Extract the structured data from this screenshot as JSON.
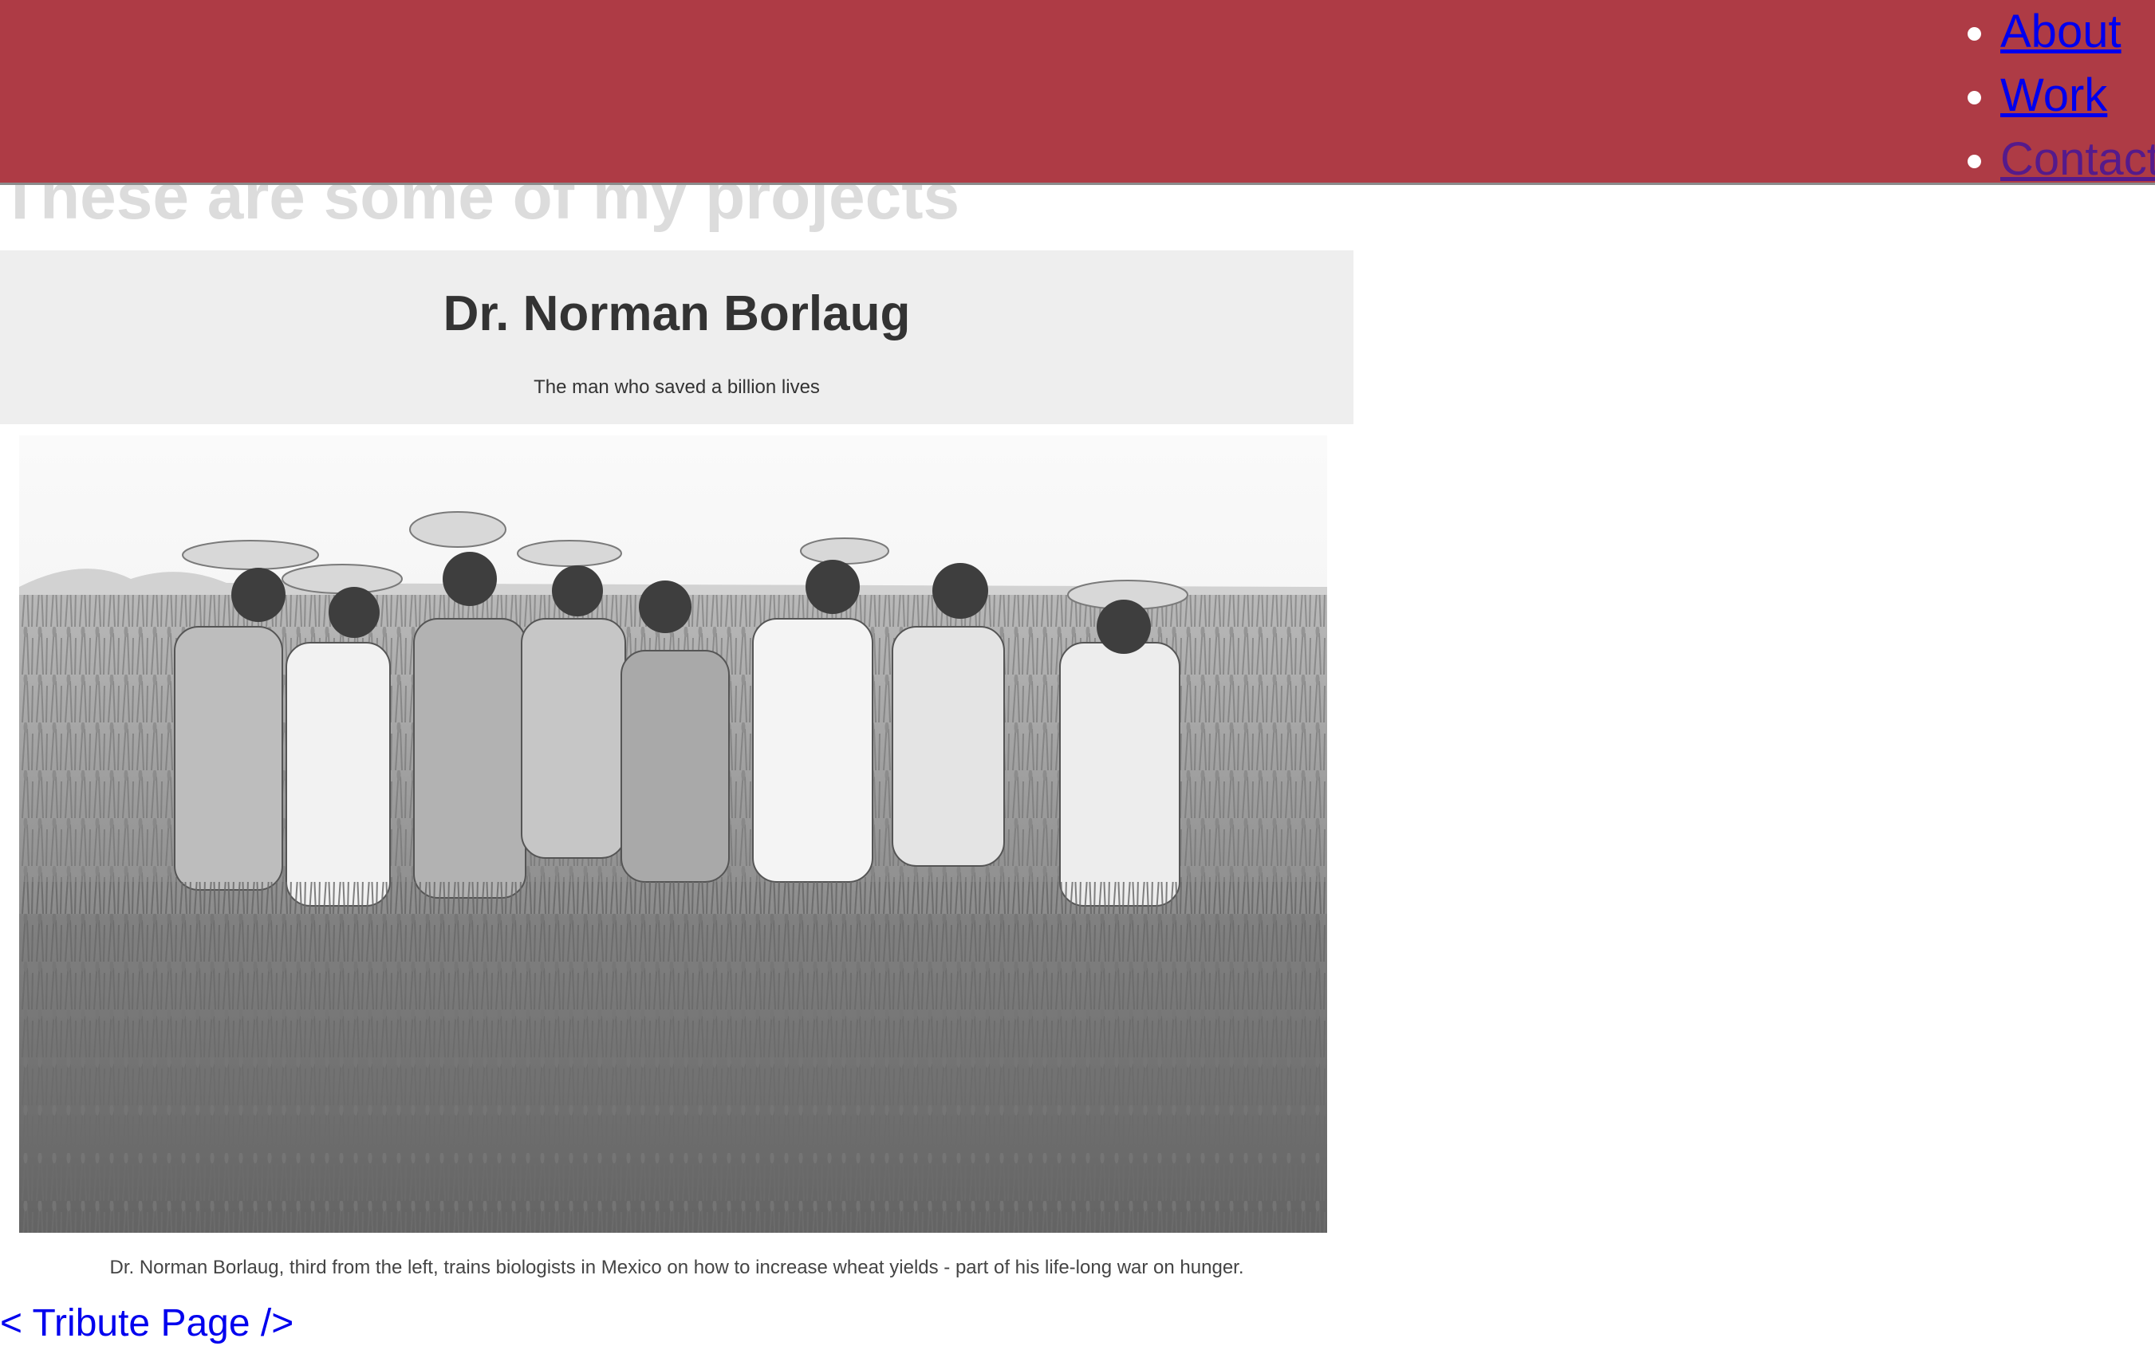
{
  "nav": {
    "items": [
      {
        "label": "About"
      },
      {
        "label": "Work"
      },
      {
        "label": "Contact"
      }
    ]
  },
  "projects": {
    "heading": "These are some of my projects",
    "tile": {
      "title": "Dr. Norman Borlaug",
      "subtitle": "The man who saved a billion lives",
      "caption": "Dr. Norman Borlaug, third from the left, trains biologists in Mexico on how to increase wheat yields - part of his life-long war on hunger.",
      "link_text": "< Tribute Page />"
    }
  },
  "colors": {
    "nav_background": "#ae3b45",
    "link": "#0000ee",
    "visited_link": "#551a8b",
    "tile_header_background": "#eeeeee"
  }
}
